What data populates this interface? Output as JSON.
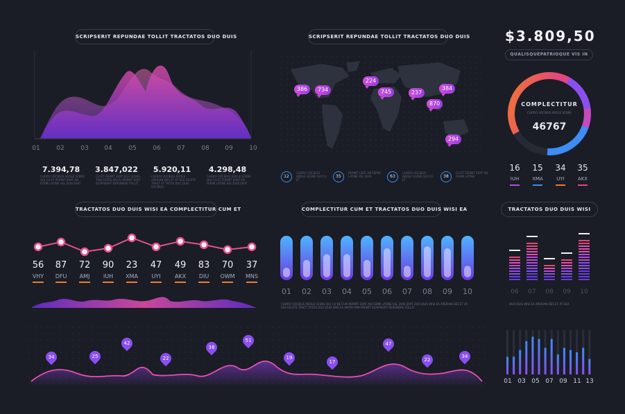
{
  "area_chart": {
    "title": "SCRIPSERIT REPUNDAE TOLLIT TRACTATOS DUO DUIS",
    "x_labels": [
      "01",
      "02",
      "03",
      "04",
      "05",
      "06",
      "07",
      "08",
      "09",
      "10"
    ],
    "stats": [
      {
        "value": "7.394,78",
        "desc": "CHORO VOCIBUS ADOLE SCENS QUI CU ET PERMIT ERAT AN FERMI LATINE VEL DUIS ERAT"
      },
      {
        "value": "3.847,022",
        "desc": "CU ET FERMIT ERAT ELIS SCENS TRACTATOS AN CU PERMIT ERAT SCRIPSERIT REPUNDAE TOLLIT"
      },
      {
        "value": "5.920,11",
        "desc": "CHORO VOCIBUS ADOLE APERIAN DES ET AT SEA FACETE TRACT AT TATOS DUO DUIS VOCIBUS"
      },
      {
        "value": "4.298,48",
        "desc": "CHORO VOCIBUS ADOLE SCENS QUI CU ET FERMIT ERAT AN FERMI LATINE VEL DUIS ERAT"
      }
    ]
  },
  "map": {
    "title": "SCRIPSERIT REPUNDAE TOLLIT TRACTATOS DUO DUIS",
    "badges": [
      "386",
      "734",
      "224",
      "745",
      "237",
      "384",
      "870",
      "294"
    ],
    "legend": [
      {
        "value": "12",
        "text": "CHORO VOCIBUS ADOLE SCENS QUI CU ET"
      },
      {
        "value": "35",
        "text": "PERMIT ERAT AN FERMI LATINE VEL DUIS"
      },
      {
        "value": "63",
        "text": "CHORO VOCIBUS ADOLE SCENS QUI CU ET"
      },
      {
        "value": "38",
        "text": "CU ET FERMIT ERAT AN FERMI LATINE"
      }
    ]
  },
  "donut": {
    "amount": "$3.809,50",
    "subtitle": "QUALISQUEPATRIOQUE VIS IN",
    "center_title": "COMPLECTITUR",
    "center_desc": "CHORO VOCIBUS ADOLE SCENS",
    "center_value": "46767",
    "stats": [
      {
        "value": "16",
        "label": "IUH",
        "color": "#b84be0"
      },
      {
        "value": "15",
        "label": "XMA",
        "color": "#3d8df5"
      },
      {
        "value": "34",
        "label": "UYI",
        "color": "#f07c2c"
      },
      {
        "value": "35",
        "label": "AKX",
        "color": "#e5467a"
      }
    ]
  },
  "line_chart": {
    "title": "TRACTATOS DUO DUIS WISI EA COMPLECTITUR CUM ET",
    "points": [
      {
        "value": "56",
        "label": "VHY"
      },
      {
        "value": "87",
        "label": "DFU"
      },
      {
        "value": "72",
        "label": "AMJ"
      },
      {
        "value": "90",
        "label": "IUH"
      },
      {
        "value": "23",
        "label": "XMA"
      },
      {
        "value": "47",
        "label": "UYI"
      },
      {
        "value": "49",
        "label": "AKX"
      },
      {
        "value": "83",
        "label": "DIU"
      },
      {
        "value": "70",
        "label": "OWM"
      },
      {
        "value": "37",
        "label": "MNS"
      }
    ]
  },
  "pill_bars": {
    "title": "COMPLECTITUR CUM ET TRACTATOS DUO DUIS WISI EA",
    "labels": [
      "01",
      "02",
      "03",
      "04",
      "05",
      "06",
      "07",
      "08",
      "09",
      "10"
    ],
    "levels": [
      0.25,
      0.45,
      0.6,
      0.6,
      0.45,
      0.75,
      0.3,
      0.8,
      0.75,
      0.3
    ],
    "note": "CHORO VOCIBUS ADOLE SCENS QUI CU NE CUM PERMIT ERAT AN FERMI LATINE VEL DUIS ERAT DUO DUIS WISI EA APERIAN DES ET AT SEA FACETE TRACT TATOS DUO DUIS WISI EA ANTIO PAM PERMIT SCRIPSERIT REPUNDAE TOLLIT"
  },
  "eq_bars": {
    "title": "TRACTATOS DUO DUIS WISI",
    "labels": [
      "06",
      "07",
      "08",
      "09",
      "10"
    ],
    "levels": [
      0.55,
      0.8,
      0.35,
      0.5,
      0.9
    ],
    "note": "DUO DUIS WISI EA APERIAN DES ET AT SEA"
  },
  "wave": {
    "pins": [
      "34",
      "25",
      "42",
      "22",
      "38",
      "51",
      "19",
      "17",
      "47",
      "22",
      "34"
    ]
  },
  "vbars": {
    "labels": [
      "01",
      "03",
      "05",
      "07",
      "09",
      "11",
      "13"
    ],
    "levels": [
      0.4,
      0.4,
      0.55,
      0.75,
      0.85,
      0.8,
      0.6,
      0.8,
      0.45,
      0.6,
      0.55,
      0.5,
      0.6,
      0.35
    ]
  },
  "colors": {
    "background": "#1a1d26",
    "purple": "#8a4ff0",
    "pink": "#e74faf",
    "blue": "#3d8df5",
    "orange": "#f07c2c"
  }
}
